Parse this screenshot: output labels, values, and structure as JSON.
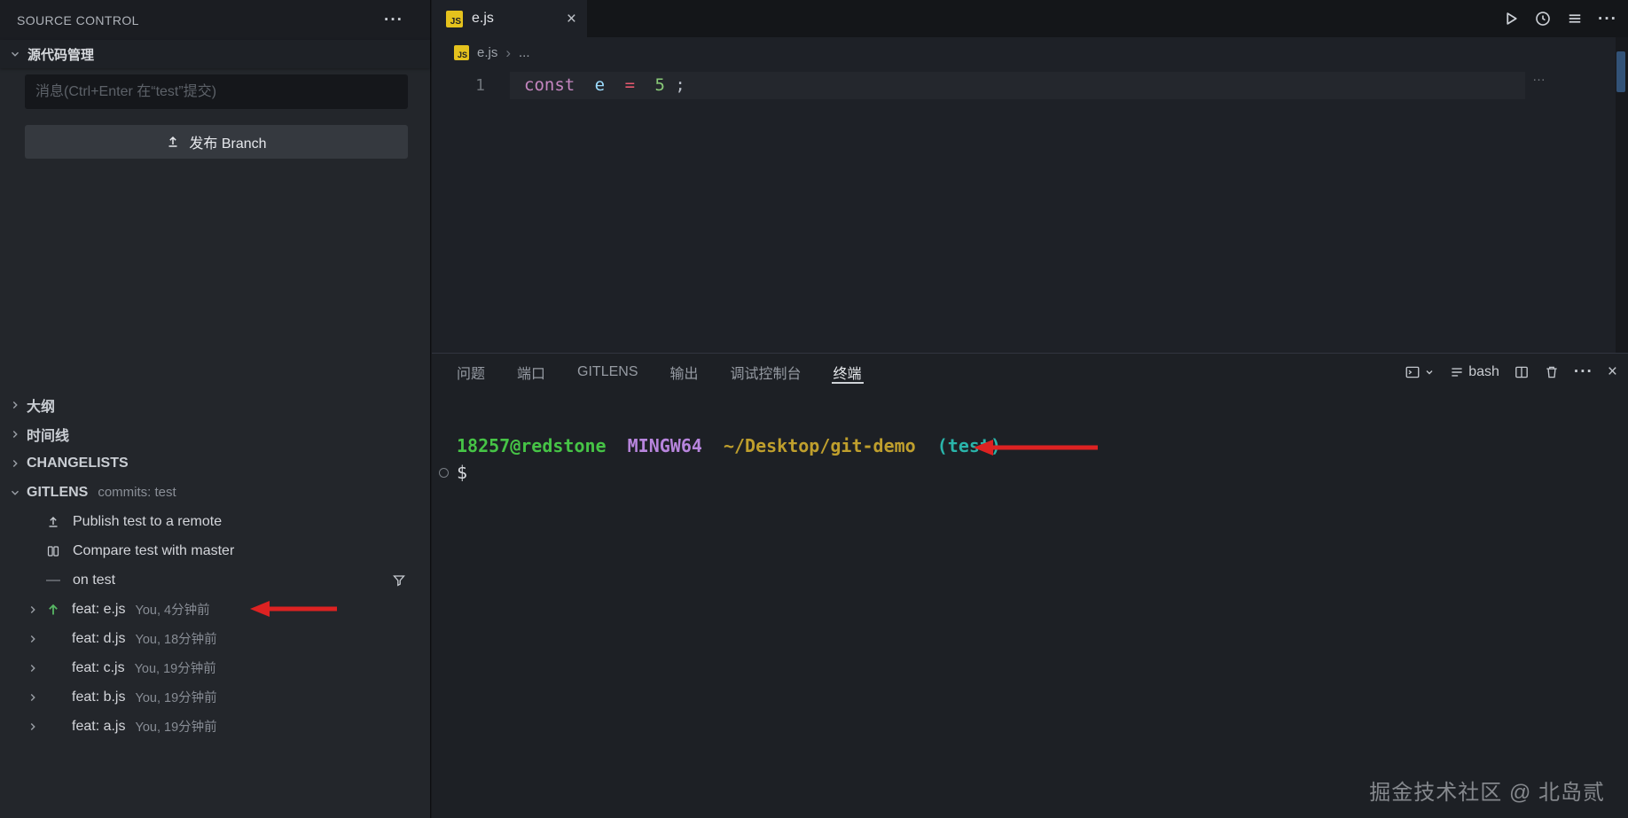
{
  "icons": {
    "ellipsis": "···",
    "close": "×",
    "js_badge": "JS",
    "dash": "—"
  },
  "sidebar": {
    "title": "SOURCE CONTROL",
    "scm_section_label": "源代码管理",
    "message_placeholder": "消息(Ctrl+Enter 在“test”提交)",
    "publish_button_label": "发布 Branch",
    "sections": [
      {
        "label": "大纲"
      },
      {
        "label": "时间线"
      },
      {
        "label": "CHANGELISTS"
      },
      {
        "label": "GITLENS",
        "description": "commits: test"
      }
    ],
    "gitlens": {
      "publish_label": "Publish test to a remote",
      "compare_label": "Compare test with master",
      "branch_label": "on test",
      "commits": [
        {
          "label": "feat: e.js",
          "meta": "You, 4分钟前"
        },
        {
          "label": "feat: d.js",
          "meta": "You, 18分钟前"
        },
        {
          "label": "feat: c.js",
          "meta": "You, 19分钟前"
        },
        {
          "label": "feat: b.js",
          "meta": "You, 19分钟前"
        },
        {
          "label": "feat: a.js",
          "meta": "You, 19分钟前"
        }
      ]
    }
  },
  "editor": {
    "tab_label": "e.js",
    "breadcrumb": {
      "file": "e.js",
      "separator": "›",
      "more": "..."
    },
    "line_number": "1",
    "code": {
      "keyword": "const",
      "variable": "e",
      "operator": "=",
      "number": "5",
      "semicolon": ";"
    },
    "inline_hint": "…"
  },
  "panel": {
    "tabs": [
      {
        "label": "问题"
      },
      {
        "label": "端口"
      },
      {
        "label": "GITLENS"
      },
      {
        "label": "输出"
      },
      {
        "label": "调试控制台"
      },
      {
        "label": "终端"
      }
    ],
    "shell_label": "bash",
    "terminal": {
      "user_host": "18257@redstone",
      "env": "MINGW64",
      "path": "~/Desktop/git-demo",
      "branch": "(test)",
      "prompt": "$"
    }
  },
  "watermark": "掘金技术社区 @ 北岛贰"
}
